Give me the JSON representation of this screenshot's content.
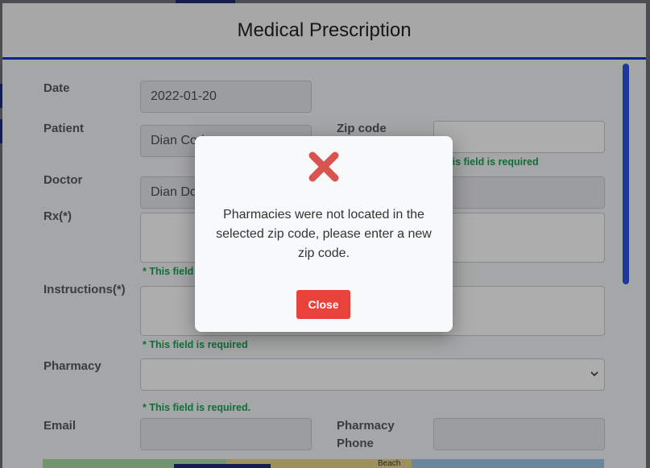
{
  "modal": {
    "title": "Medical Prescription"
  },
  "form": {
    "date": {
      "label": "Date",
      "value": "2022-01-20"
    },
    "patient": {
      "label": "Patient",
      "value": "Dian Cod"
    },
    "zip": {
      "label": "Zip code",
      "value": "",
      "error": "* This field is required"
    },
    "doctor": {
      "label": "Doctor",
      "value": "Dian Do"
    },
    "rx": {
      "label": "Rx(*)",
      "value": "",
      "error": "* This field"
    },
    "instructions": {
      "label": "Instructions(*)",
      "value": "",
      "error": "* This field is required"
    },
    "pharmacy": {
      "label": "Pharmacy",
      "selected": "",
      "error": "* This field is required."
    },
    "email": {
      "label": "Email",
      "value": ""
    },
    "pharmacy_phone": {
      "label": "Pharmacy Phone",
      "value": ""
    },
    "map_label": "Beach"
  },
  "dialog": {
    "icon": "error-x-icon",
    "message": "Pharmacies were not located in the selected zip code, please enter a new zip code.",
    "close_label": "Close",
    "icon_color": "#d9534f",
    "button_color": "#e8423a"
  },
  "colors": {
    "header_border": "#1133cc",
    "required_text": "#1aa251",
    "scrollbar": "#2a55e0"
  }
}
